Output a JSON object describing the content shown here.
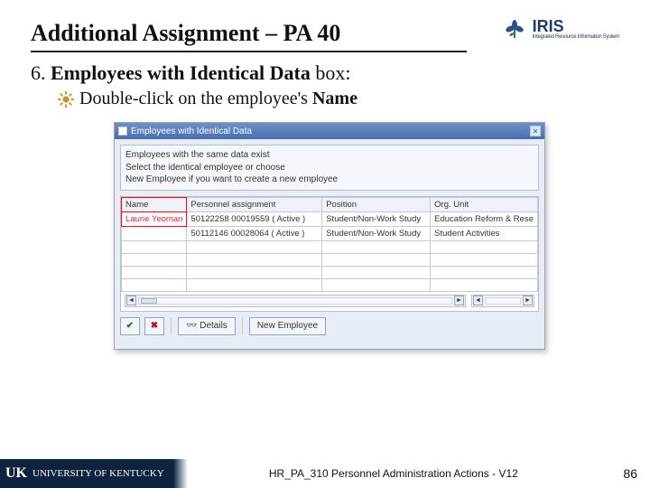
{
  "header": {
    "title": "Additional Assignment – PA 40",
    "logo_big": "IRIS",
    "logo_small": "Integrated Resource Information System"
  },
  "step": {
    "number": "6.",
    "bold_part": "Employees with Identical Data",
    "suffix": " box:"
  },
  "bullet": {
    "prefix": "Double-click on the employee's ",
    "bold": "Name"
  },
  "window": {
    "title": "Employees with Identical Data",
    "close_glyph": "✕",
    "info_line1": "Employees with the same data exist",
    "info_line2": "Select the identical employee or choose",
    "info_line3": "New Employee if you want to create a new employee",
    "columns": {
      "name": "Name",
      "assignment": "Personnel assignment",
      "position": "Position",
      "org": "Org. Unit"
    },
    "rows": [
      {
        "name": "Laurie Yeoman",
        "assignment": "50122258 00019559 ( Active )",
        "position": "Student/Non-Work Study",
        "org": "Education Reform & Rese"
      },
      {
        "name": "",
        "assignment": "50112146 00028064 ( Active )",
        "position": "Student/Non-Work Study",
        "org": "Student Activities"
      }
    ],
    "scroll": {
      "left": "◄",
      "right": "►"
    },
    "buttons": {
      "check": "✔",
      "x": "✖",
      "details": "Details",
      "new_emp": "New Employee"
    }
  },
  "footer": {
    "uk_mark": "UK",
    "uk_text": "UNIVERSITY OF KENTUCKY",
    "center": "HR_PA_310 Personnel Administration Actions - V12",
    "page": "86"
  }
}
